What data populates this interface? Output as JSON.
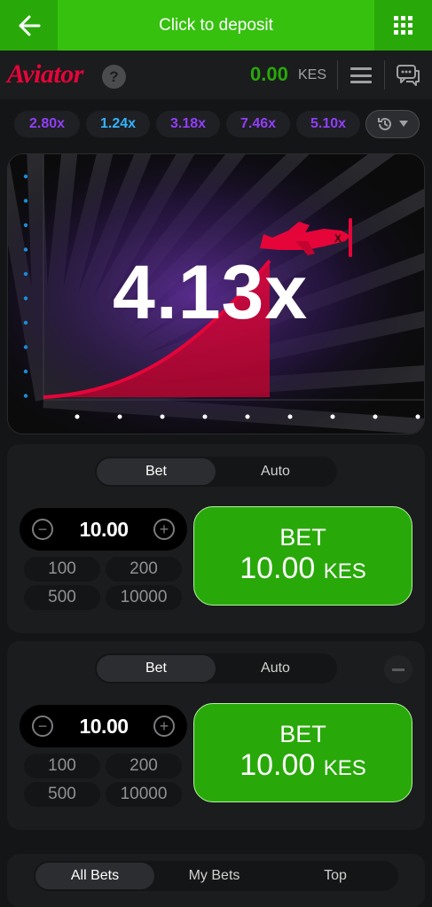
{
  "topbar": {
    "deposit_label": "Click to deposit"
  },
  "header": {
    "logo": "Aviator",
    "help": "?",
    "balance": "0.00",
    "currency": "KES"
  },
  "history": [
    {
      "value": "2.80x",
      "color": "#913ef8"
    },
    {
      "value": "1.24x",
      "color": "#34b4ff"
    },
    {
      "value": "3.18x",
      "color": "#913ef8"
    },
    {
      "value": "7.46x",
      "color": "#913ef8"
    },
    {
      "value": "5.10x",
      "color": "#913ef8"
    }
  ],
  "game": {
    "multiplier": "4.13x"
  },
  "panels": [
    {
      "tabs": [
        "Bet",
        "Auto"
      ],
      "amount": "10.00",
      "quick": [
        "100",
        "200",
        "500",
        "10000"
      ],
      "bet_label": "BET",
      "bet_amount": "10.00",
      "bet_currency": "KES"
    },
    {
      "tabs": [
        "Bet",
        "Auto"
      ],
      "amount": "10.00",
      "quick": [
        "100",
        "200",
        "500",
        "10000"
      ],
      "bet_label": "BET",
      "bet_amount": "10.00",
      "bet_currency": "KES"
    }
  ],
  "bets_tabs": [
    "All Bets",
    "My Bets",
    "Top"
  ],
  "colors": {
    "accent_green": "#28a909",
    "brand_red": "#e50539",
    "purple": "#913ef8",
    "blue": "#34b4ff"
  }
}
